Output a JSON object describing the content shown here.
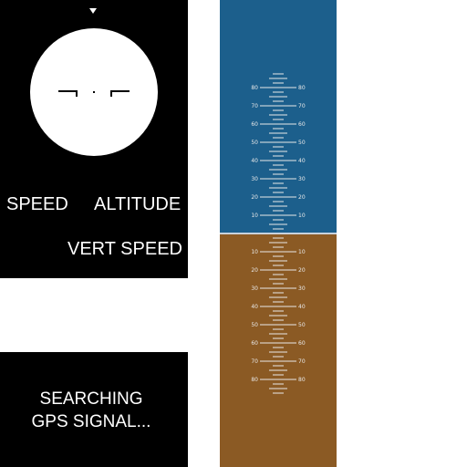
{
  "flight_display": {
    "heading_marker": "caret-down-icon",
    "labels": {
      "speed": "SPEED",
      "altitude": "ALTITUDE",
      "vert_speed": "VERT SPEED"
    },
    "status": {
      "line1": "SEARCHING",
      "line2": "GPS SIGNAL..."
    },
    "pitch_ladder": {
      "sky_color": "#1c5f8c",
      "ground_color": "#8b5a24",
      "horizon_color": "#c8d2dc",
      "marking_color": "#e8e8e8",
      "up_labels": [
        "80",
        "70",
        "60",
        "50",
        "40",
        "30",
        "20",
        "10"
      ],
      "down_labels": [
        "10",
        "20",
        "30",
        "40",
        "50",
        "60",
        "70",
        "80"
      ]
    }
  }
}
